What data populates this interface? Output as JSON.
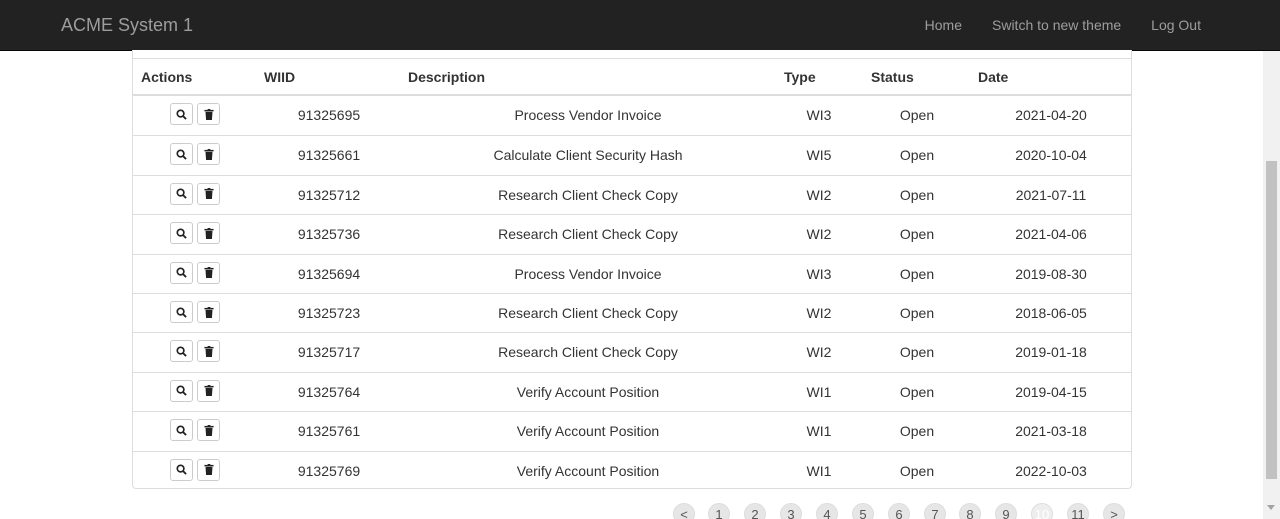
{
  "navbar": {
    "brand": "ACME System 1",
    "links": [
      "Home",
      "Switch to new theme",
      "Log Out"
    ]
  },
  "table": {
    "headers": [
      "Actions",
      "WIID",
      "Description",
      "Type",
      "Status",
      "Date"
    ],
    "rows": [
      {
        "wiid": "91325695",
        "description": "Process Vendor Invoice",
        "type": "WI3",
        "status": "Open",
        "date": "2021-04-20"
      },
      {
        "wiid": "91325661",
        "description": "Calculate Client Security Hash",
        "type": "WI5",
        "status": "Open",
        "date": "2020-10-04"
      },
      {
        "wiid": "91325712",
        "description": "Research Client Check Copy",
        "type": "WI2",
        "status": "Open",
        "date": "2021-07-11"
      },
      {
        "wiid": "91325736",
        "description": "Research Client Check Copy",
        "type": "WI2",
        "status": "Open",
        "date": "2021-04-06"
      },
      {
        "wiid": "91325694",
        "description": "Process Vendor Invoice",
        "type": "WI3",
        "status": "Open",
        "date": "2019-08-30"
      },
      {
        "wiid": "91325723",
        "description": "Research Client Check Copy",
        "type": "WI2",
        "status": "Open",
        "date": "2018-06-05"
      },
      {
        "wiid": "91325717",
        "description": "Research Client Check Copy",
        "type": "WI2",
        "status": "Open",
        "date": "2019-01-18"
      },
      {
        "wiid": "91325764",
        "description": "Verify Account Position",
        "type": "WI1",
        "status": "Open",
        "date": "2019-04-15"
      },
      {
        "wiid": "91325761",
        "description": "Verify Account Position",
        "type": "WI1",
        "status": "Open",
        "date": "2021-03-18"
      },
      {
        "wiid": "91325769",
        "description": "Verify Account Position",
        "type": "WI1",
        "status": "Open",
        "date": "2022-10-03"
      }
    ],
    "row_actions": [
      "search-icon",
      "trash-icon"
    ]
  },
  "pagination": {
    "items": [
      "<",
      "1",
      "2",
      "3",
      "4",
      "5",
      "6",
      "7",
      "8",
      "9",
      "10",
      "11",
      ">"
    ],
    "active": "10"
  },
  "colors": {
    "navbar_bg": "#222222",
    "navbar_text": "#9d9d9d",
    "border": "#dddddd"
  }
}
